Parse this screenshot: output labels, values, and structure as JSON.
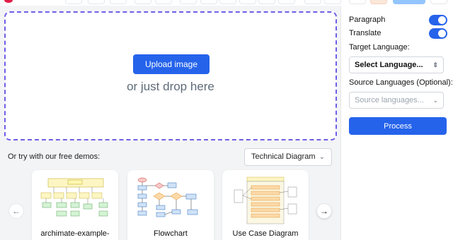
{
  "upload": {
    "button_label": "Upload image",
    "drop_text": "or just drop here"
  },
  "demos": {
    "label": "Or try with our free demos:",
    "category_selected": "Technical Diagram",
    "prev_icon": "←",
    "next_icon": "→",
    "cards": [
      {
        "label": "archimate-example-",
        "thumbnail": "archimate-diagram-thumbnail"
      },
      {
        "label": "Flowchart",
        "thumbnail": "flowchart-thumbnail"
      },
      {
        "label": "Use Case Diagram",
        "thumbnail": "use-case-diagram-thumbnail"
      }
    ]
  },
  "settings": {
    "paragraph_label": "Paragraph",
    "paragraph_on": true,
    "translate_label": "Translate",
    "translate_on": true,
    "target_language_label": "Target Language:",
    "target_language_value": "Select Language...",
    "source_languages_label": "Source Languages (Optional):",
    "source_languages_placeholder": "Source languages...",
    "process_label": "Process"
  },
  "colors": {
    "accent": "#2563eb",
    "dropzone_border": "#6d5fe6"
  }
}
